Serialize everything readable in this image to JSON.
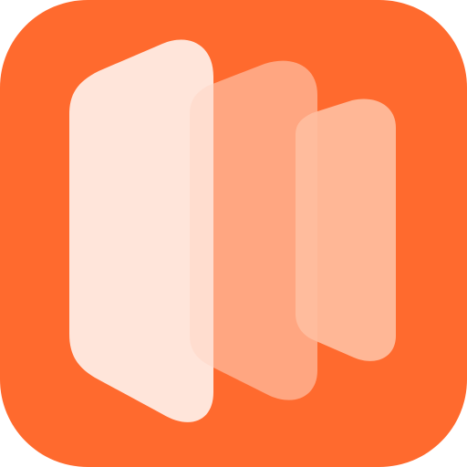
{
  "icon": {
    "name": "panels-app-icon",
    "colors": {
      "background": "#FF6A2E",
      "panel_back": "#FFE9E0",
      "panel_middle": "#FFD7C7",
      "panel_front": "#FFBE9F"
    }
  }
}
